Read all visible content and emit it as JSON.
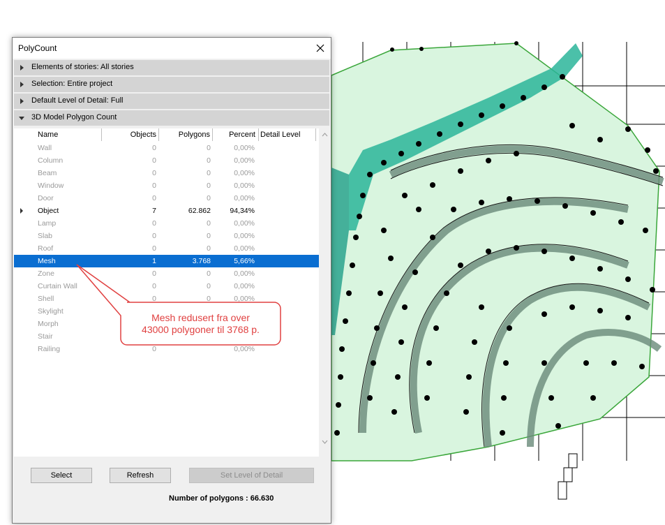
{
  "dialog": {
    "title": "PolyCount",
    "sections": [
      {
        "label": "Elements of stories: All stories"
      },
      {
        "label": "Selection: Entire project"
      },
      {
        "label": "Default Level of Detail: Full"
      },
      {
        "label": "3D Model Polygon Count"
      }
    ],
    "table": {
      "headers": {
        "name": "Name",
        "objects": "Objects",
        "polygons": "Polygons",
        "percent": "Percent",
        "detail": "Detail Level"
      },
      "rows": [
        {
          "name": "Wall",
          "objects": "0",
          "polygons": "0",
          "percent": "0,00%"
        },
        {
          "name": "Column",
          "objects": "0",
          "polygons": "0",
          "percent": "0,00%"
        },
        {
          "name": "Beam",
          "objects": "0",
          "polygons": "0",
          "percent": "0,00%"
        },
        {
          "name": "Window",
          "objects": "0",
          "polygons": "0",
          "percent": "0,00%"
        },
        {
          "name": "Door",
          "objects": "0",
          "polygons": "0",
          "percent": "0,00%"
        },
        {
          "name": "Object",
          "objects": "7",
          "polygons": "62.862",
          "percent": "94,34%"
        },
        {
          "name": "Lamp",
          "objects": "0",
          "polygons": "0",
          "percent": "0,00%"
        },
        {
          "name": "Slab",
          "objects": "0",
          "polygons": "0",
          "percent": "0,00%"
        },
        {
          "name": "Roof",
          "objects": "0",
          "polygons": "0",
          "percent": "0,00%"
        },
        {
          "name": "Mesh",
          "objects": "1",
          "polygons": "3.768",
          "percent": "5,66%"
        },
        {
          "name": "Zone",
          "objects": "0",
          "polygons": "0",
          "percent": "0,00%"
        },
        {
          "name": "Curtain Wall",
          "objects": "0",
          "polygons": "0",
          "percent": "0,00%"
        },
        {
          "name": "Shell",
          "objects": "0",
          "polygons": "0",
          "percent": "0,00%"
        },
        {
          "name": "Skylight",
          "objects": "",
          "polygons": "",
          "percent": ""
        },
        {
          "name": "Morph",
          "objects": "",
          "polygons": "",
          "percent": ""
        },
        {
          "name": "Stair",
          "objects": "",
          "polygons": "",
          "percent": ""
        },
        {
          "name": "Railing",
          "objects": "0",
          "polygons": "",
          "percent": "0,00%"
        }
      ]
    },
    "buttons": {
      "select": "Select",
      "refresh": "Refresh",
      "set_lod": "Set Level of Detail"
    },
    "total": "Number of polygons : 66.630"
  },
  "callout": {
    "line1": "Mesh redusert fra over",
    "line2": "43000 polygoner til 3768 p."
  },
  "colors": {
    "accent": "#0a6ed1",
    "callout_border": "#e04040",
    "map_fill": "#d9f5df",
    "map_teal": "#2bb59a"
  },
  "icons": {
    "close": "close-icon",
    "expand": "triangle-icon"
  }
}
